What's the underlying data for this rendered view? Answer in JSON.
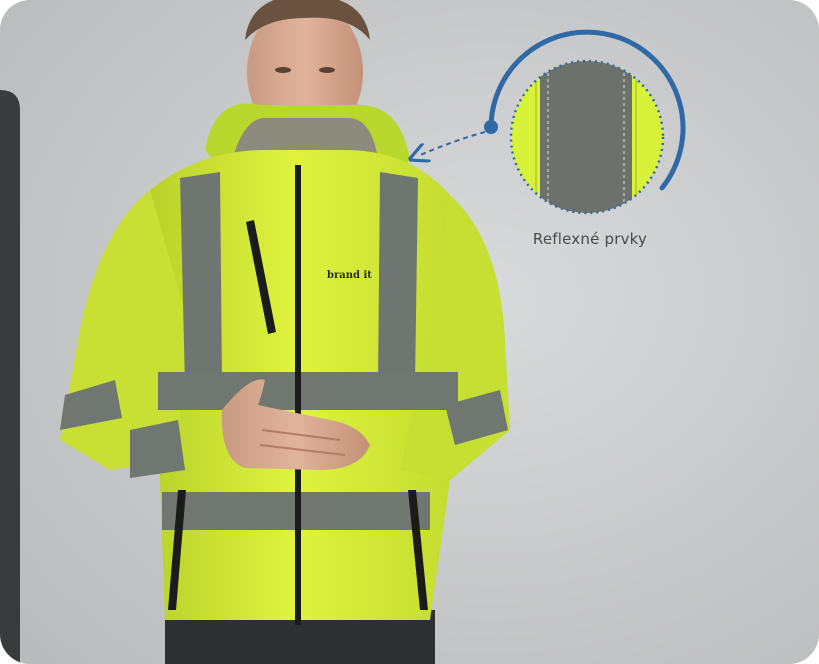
{
  "callout": {
    "label": "Reflexné prvky"
  },
  "jacket": {
    "brand_text": "brand it",
    "main_color": "#d8f23a",
    "reflective_color": "#707670",
    "zipper_color": "#1b1b1b"
  },
  "theme": {
    "background": "#c9cacb",
    "callout_ring_color": "#2f6aa6"
  }
}
